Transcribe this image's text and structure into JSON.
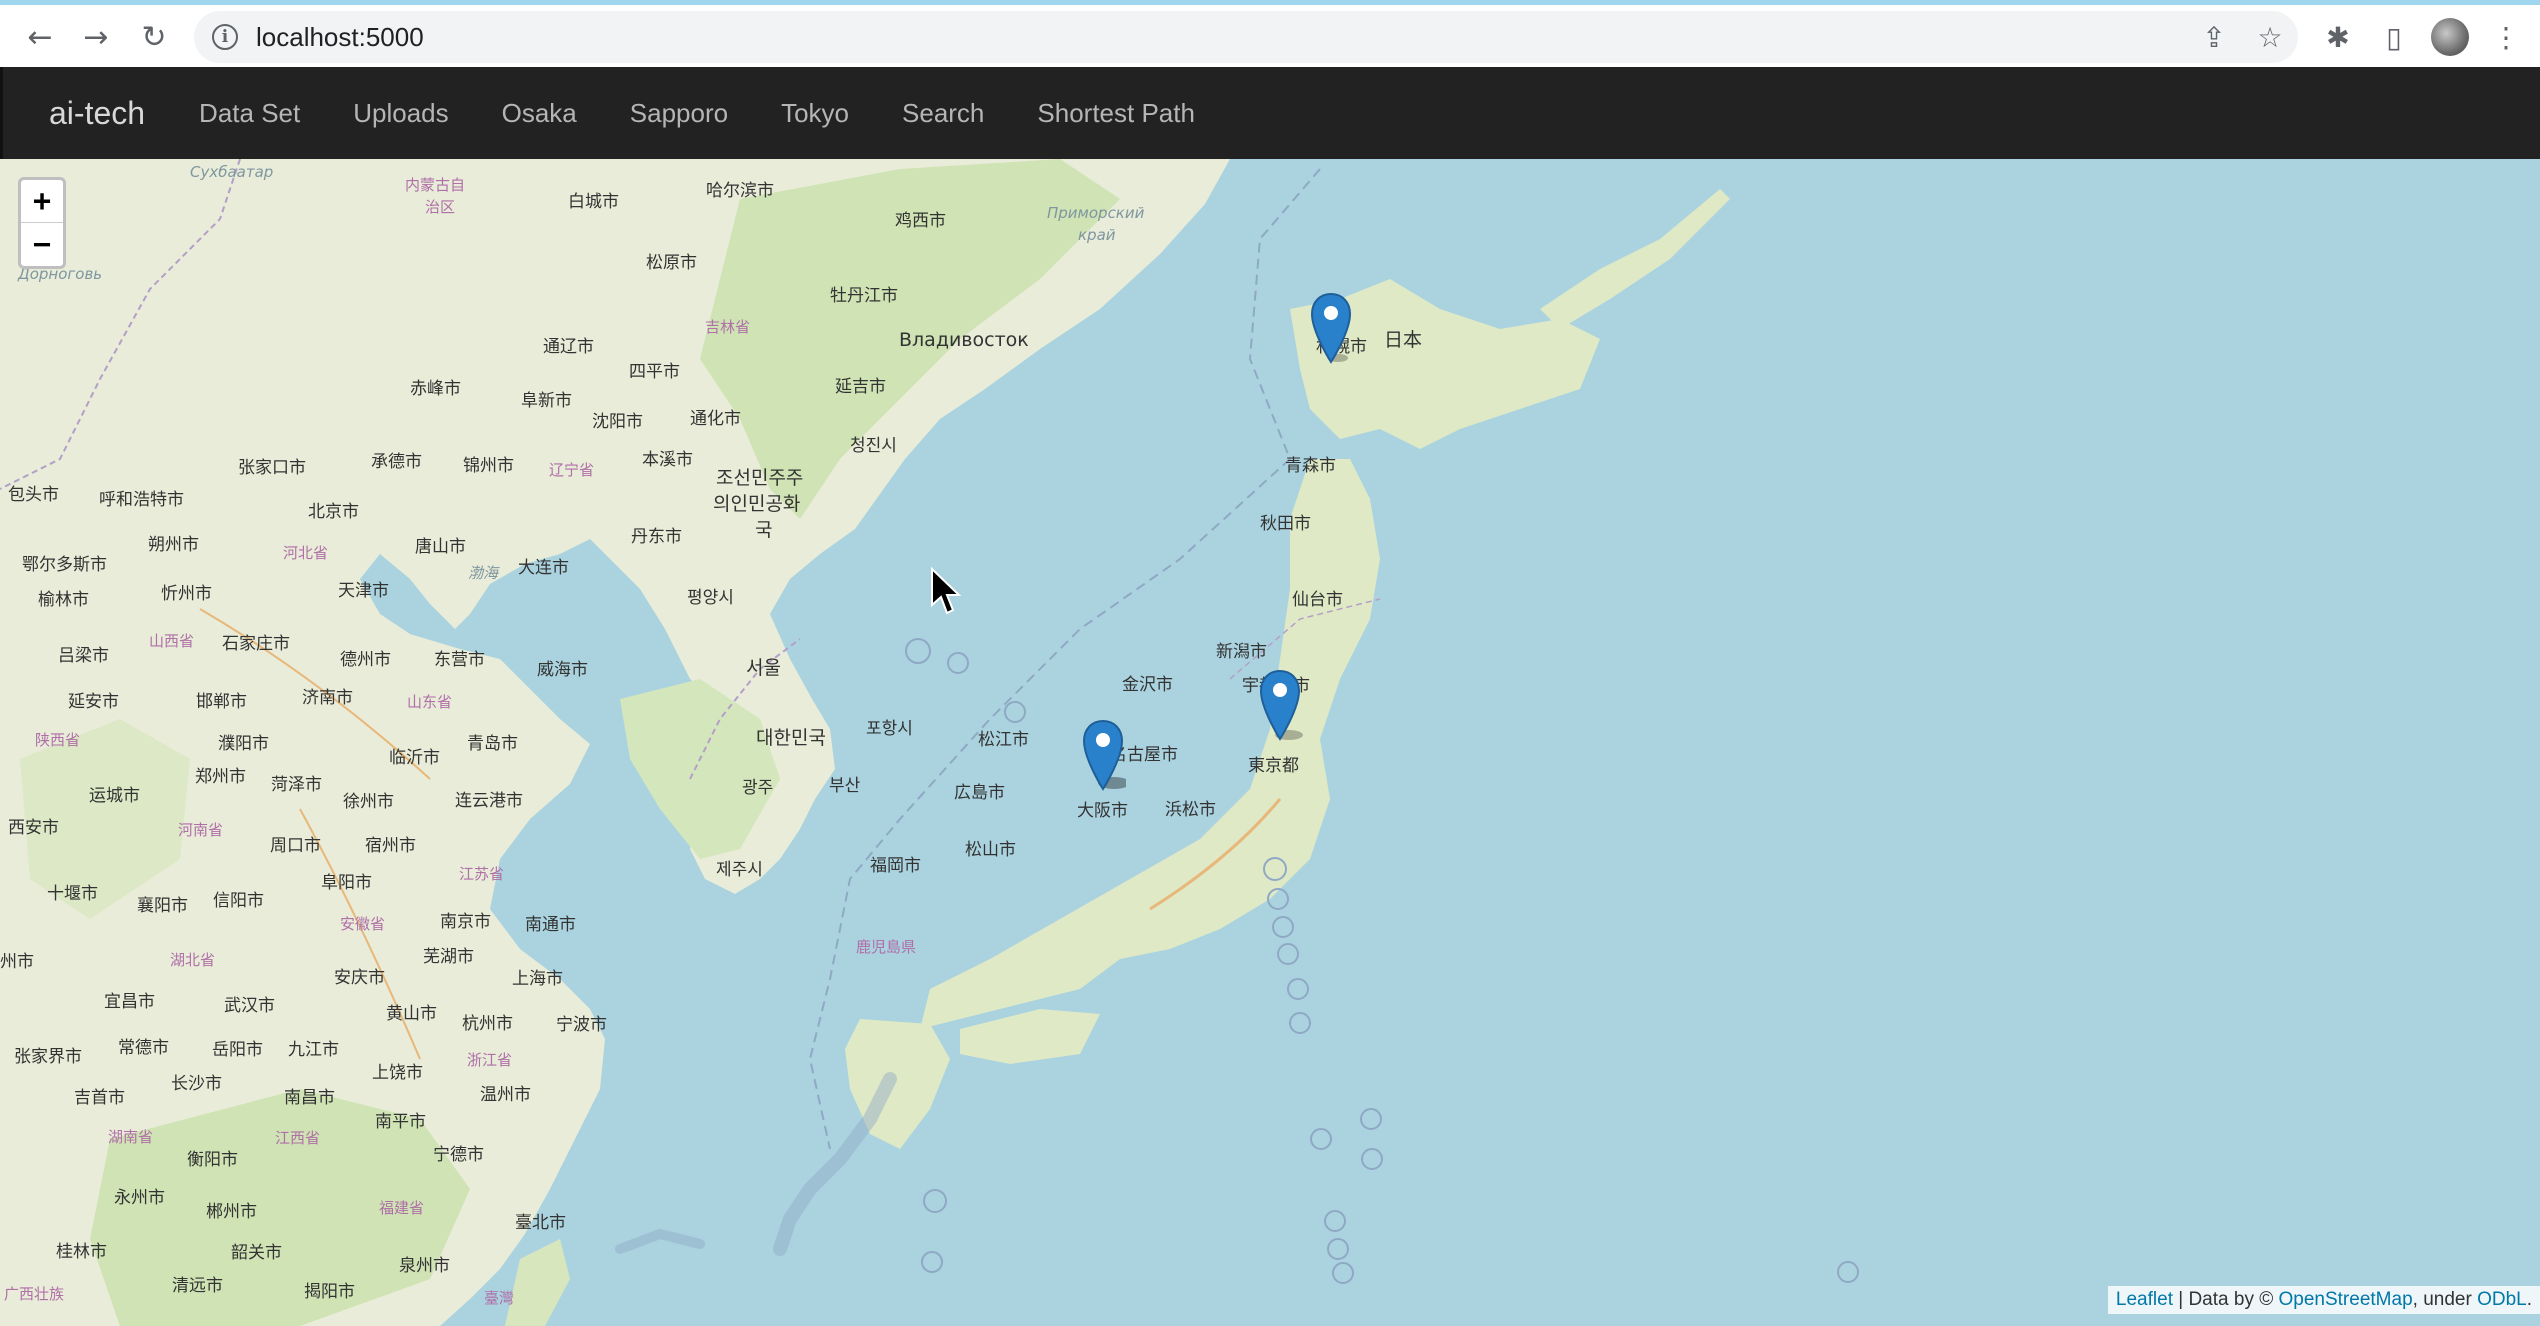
{
  "browser": {
    "url": "localhost:5000"
  },
  "navbar": {
    "brand": "ai-tech",
    "links": [
      "Data Set",
      "Uploads",
      "Osaka",
      "Sapporo",
      "Tokyo",
      "Search",
      "Shortest Path"
    ]
  },
  "map": {
    "zoom_in": "+",
    "zoom_out": "−",
    "markers": [
      {
        "name": "Sapporo",
        "icon": "map-pin-icon",
        "color": "#2a81cb"
      },
      {
        "name": "Tokyo",
        "icon": "map-pin-icon",
        "color": "#2a81cb"
      },
      {
        "name": "Osaka",
        "icon": "map-pin-icon",
        "color": "#2a81cb"
      }
    ],
    "labels": {
      "subaatar": "Сухбаатар",
      "neimenggu": "内蒙古自",
      "neimenggu2": "治区",
      "baicheng": "白城市",
      "haerbin": "哈尔滨市",
      "jixi": "鸡西市",
      "primorsky": "Приморский",
      "krai": "край",
      "songyuan": "松原市",
      "mudanjiang": "牡丹江市",
      "jilinprov": "吉林省",
      "dornogovi": "Дорноговь",
      "tongliao": "通辽市",
      "vladivostok": "Владивосток",
      "chifeng": "赤峰市",
      "fuxin": "阜新市",
      "siping": "四平市",
      "yanji": "延吉市",
      "shenyang": "沈阳市",
      "tonghua": "通化市",
      "chongjin": "청진시",
      "zhangjiakou": "张家口市",
      "chengde": "承德市",
      "jinzhou": "锦州市",
      "liaoning": "辽宁省",
      "benxi": "本溪市",
      "dprk1": "조선민주주",
      "dprk2": "의인민공화",
      "dprk3": "국",
      "baotou": "包头市",
      "huhehaote": "呼和浩特市",
      "beijing": "北京市",
      "shuozhou": "朔州市",
      "hebei": "河北省",
      "tangshan": "唐山市",
      "dandong": "丹东市",
      "eerduosi": "鄂尔多斯市",
      "dalian": "大连市",
      "bohai": "渤海",
      "pyongyang": "평양시",
      "yulin": "榆林市",
      "xinzhou": "忻州市",
      "tianjin": "天津市",
      "lvliang": "吕梁市",
      "shanxi": "山西省",
      "shijiazhuang": "石家庄市",
      "dezhou": "德州市",
      "dongying": "东营市",
      "weihai": "威海市",
      "seoul": "서울",
      "yanan": "延安市",
      "handan": "邯郸市",
      "jinan": "济南市",
      "shandong": "山东省",
      "shaanxi": "陕西省",
      "puyang": "濮阳市",
      "linyi": "临沂市",
      "qingdao": "青岛市",
      "korea": "대한민국",
      "pohang": "포항시",
      "zhengzhou": "郑州市",
      "heze": "菏泽市",
      "yuncheng": "运城市",
      "xuzhou": "徐州市",
      "lianyungang": "连云港市",
      "gwangju": "광주",
      "busan": "부산",
      "xian": "西安市",
      "henan": "河南省",
      "zhoukou": "周口市",
      "suzhou": "宿州市",
      "jiangsu": "江苏省",
      "fuyang": "阜阳市",
      "jeju": "제주시",
      "shiyan": "十堰市",
      "xiangyang": "襄阳市",
      "xinyang": "信阳市",
      "anhui": "安徽省",
      "nanjing": "南京市",
      "nantong": "南通市",
      "hubei": "湖北省",
      "wuhu": "芜湖市",
      "zhou": "州市",
      "yichang": "宜昌市",
      "wuhan": "武汉市",
      "anqing": "安庆市",
      "shanghai": "上海市",
      "huangshan": "黄山市",
      "hangzhou": "杭州市",
      "ningbo": "宁波市",
      "zhangjiajie": "张家界市",
      "changde": "常德市",
      "yueyang": "岳阳市",
      "jiujiang": "九江市",
      "shangrao": "上饶市",
      "zhejiang": "浙江省",
      "jishou": "吉首市",
      "changsha": "长沙市",
      "nanchang": "南昌市",
      "wenzhou": "温州市",
      "hunan": "湖南省",
      "jiangxi": "江西省",
      "nanping": "南平市",
      "ningde": "宁德市",
      "hengyang": "衡阳市",
      "yongzhou": "永州市",
      "chenzhou": "郴州市",
      "fujian": "福建省",
      "taibei": "臺北市",
      "guilin": "桂林市",
      "shaoguan": "韶关市",
      "quanzhou": "泉州市",
      "guangxi": "广西壮族",
      "qingyuan": "清远市",
      "jieyang": "揭阳市",
      "taiwan": "臺灣",
      "sapporo": "札幌市",
      "japan": "日本",
      "aomori": "青森市",
      "akita": "秋田市",
      "sendai": "仙台市",
      "niigata": "新潟市",
      "kanazawa": "金沢市",
      "utsunomiya": "宇都宮市",
      "matsue": "松江市",
      "nagoya": "名古屋市",
      "tokyo": "東京都",
      "hiroshima": "広島市",
      "osaka": "大阪市",
      "hamamatsu": "浜松市",
      "matsuyama": "松山市",
      "fukuoka": "福岡市",
      "kagoshima": "鹿児島県"
    },
    "attribution": {
      "leaflet": "Leaflet",
      "data_by": " | Data by © ",
      "osm": "OpenStreetMap",
      "under": ", under ",
      "odbl": "ODbL",
      "dot": "."
    }
  }
}
